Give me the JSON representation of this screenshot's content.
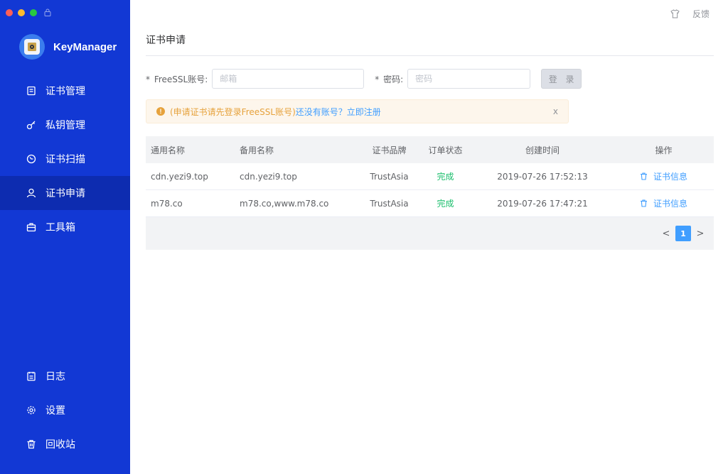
{
  "app": {
    "name": "KeyManager"
  },
  "sidebar": {
    "items": [
      {
        "label": "证书管理",
        "icon": "save-icon"
      },
      {
        "label": "私钥管理",
        "icon": "key-icon"
      },
      {
        "label": "证书扫描",
        "icon": "scan-clock-icon"
      },
      {
        "label": "证书申请",
        "icon": "user-icon",
        "active": true
      },
      {
        "label": "工具箱",
        "icon": "toolbox-icon"
      }
    ],
    "bottom_items": [
      {
        "label": "日志",
        "icon": "log-icon"
      },
      {
        "label": "设置",
        "icon": "gear-icon"
      },
      {
        "label": "回收站",
        "icon": "trash-icon"
      }
    ]
  },
  "topbar": {
    "feedback": "反馈"
  },
  "page": {
    "title": "证书申请"
  },
  "form": {
    "account_label": "FreeSSL账号",
    "account_placeholder": "邮箱",
    "password_label": "密码",
    "password_placeholder": "密码",
    "login_button": "登 录",
    "required_mark": "*",
    "colon": ":"
  },
  "alert": {
    "text": "(申请证书请先登录FreeSSL账号)",
    "link": "还没有账号？立即注册",
    "close": "x"
  },
  "table": {
    "columns": [
      "通用名称",
      "备用名称",
      "证书品牌",
      "订单状态",
      "创建时间",
      "操作"
    ],
    "rows": [
      {
        "common_name": "cdn.yezi9.top",
        "alt_name": "cdn.yezi9.top",
        "brand": "TrustAsia",
        "status": "完成",
        "created": "2019-07-26 17:52:13",
        "action": "证书信息"
      },
      {
        "common_name": "m78.co",
        "alt_name": "m78.co,www.m78.co",
        "brand": "TrustAsia",
        "status": "完成",
        "created": "2019-07-26 17:47:21",
        "action": "证书信息"
      }
    ]
  },
  "pagination": {
    "current": "1",
    "prev": "<",
    "next": ">"
  },
  "colors": {
    "sidebar": "#1238d4",
    "sidebar_active": "#0d2cb0",
    "link": "#409eff",
    "success": "#19be6b",
    "warning": "#e6a23c"
  }
}
